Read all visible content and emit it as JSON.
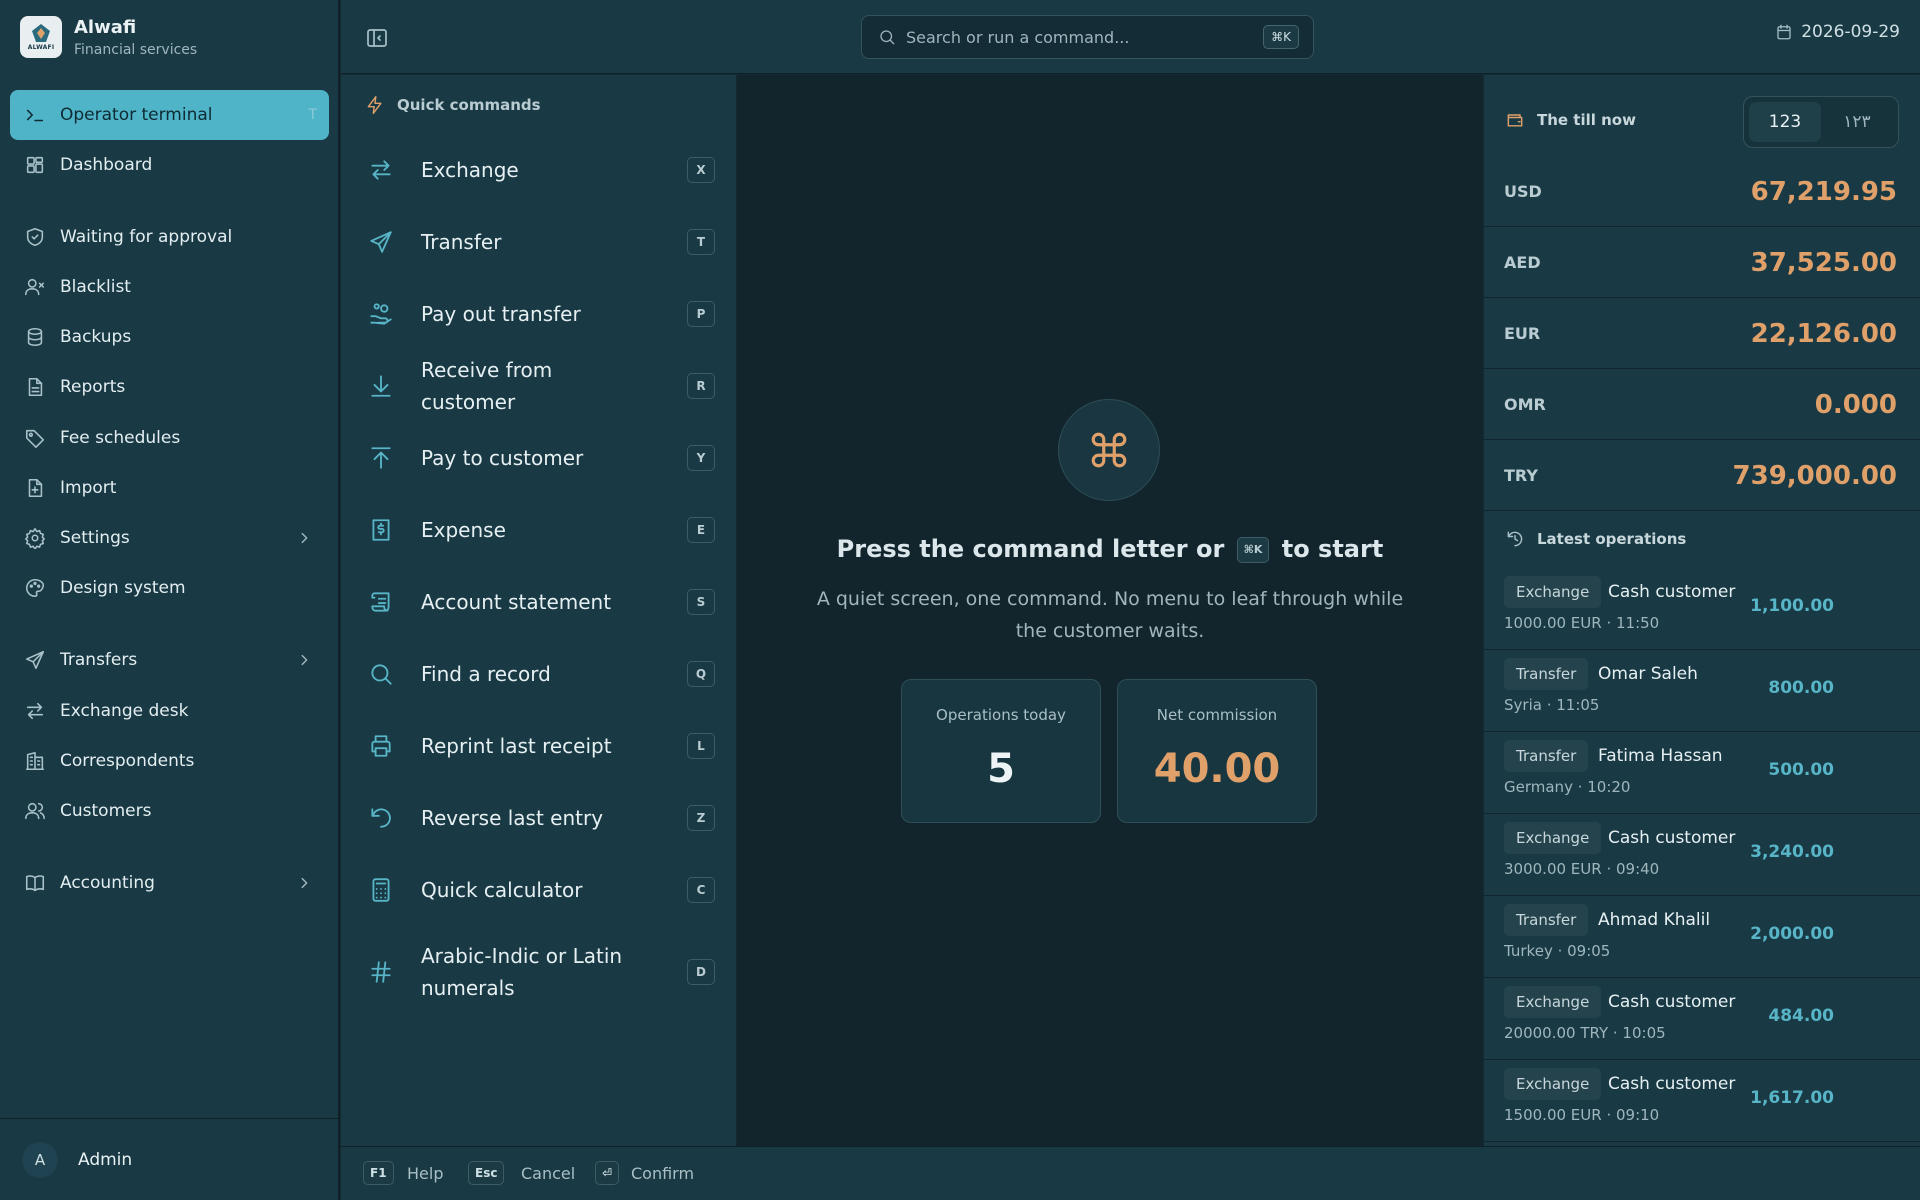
{
  "app": {
    "name": "Alwafi",
    "subtitle": "Financial services",
    "logo_text": "ALWAFI"
  },
  "sidebar": {
    "items": [
      {
        "label": "Operator terminal",
        "shortcut": "T",
        "icon": "terminal-icon",
        "active": true
      },
      {
        "label": "Dashboard",
        "icon": "dashboard-icon"
      },
      {
        "label": "Waiting for approval",
        "icon": "shield-check-icon"
      },
      {
        "label": "Blacklist",
        "icon": "user-x-icon"
      },
      {
        "label": "Backups",
        "icon": "database-icon"
      },
      {
        "label": "Reports",
        "icon": "file-text-icon"
      },
      {
        "label": "Fee schedules",
        "icon": "tag-icon"
      },
      {
        "label": "Import",
        "icon": "file-plus-icon"
      },
      {
        "label": "Settings",
        "icon": "gear-icon",
        "expandable": true
      },
      {
        "label": "Design system",
        "icon": "palette-icon"
      },
      {
        "label": "Transfers",
        "icon": "send-icon",
        "expandable": true
      },
      {
        "label": "Exchange desk",
        "icon": "arrows-exchange-icon"
      },
      {
        "label": "Correspondents",
        "icon": "building-icon"
      },
      {
        "label": "Customers",
        "icon": "users-icon"
      },
      {
        "label": "Accounting",
        "icon": "book-icon",
        "expandable": true
      }
    ],
    "user": {
      "initial": "A",
      "name": "Admin"
    }
  },
  "topbar": {
    "search_placeholder": "Search or run a command...",
    "search_shortcut": "⌘K",
    "date": "2026-09-29"
  },
  "commands": {
    "title": "Quick commands",
    "items": [
      {
        "label": "Exchange",
        "key": "X",
        "icon": "arrows-exchange-icon"
      },
      {
        "label": "Transfer",
        "key": "T",
        "icon": "send-icon"
      },
      {
        "label": "Pay out transfer",
        "key": "P",
        "icon": "hand-coins-icon"
      },
      {
        "label": "Receive from customer",
        "key": "R",
        "icon": "arrow-down-icon"
      },
      {
        "label": "Pay to customer",
        "key": "Y",
        "icon": "arrow-up-icon"
      },
      {
        "label": "Expense",
        "key": "E",
        "icon": "receipt-dollar-icon"
      },
      {
        "label": "Account statement",
        "key": "S",
        "icon": "scroll-icon"
      },
      {
        "label": "Find a record",
        "key": "Q",
        "icon": "search-icon"
      },
      {
        "label": "Reprint last receipt",
        "key": "L",
        "icon": "printer-icon"
      },
      {
        "label": "Reverse last entry",
        "key": "Z",
        "icon": "undo-icon"
      },
      {
        "label": "Quick calculator",
        "key": "C",
        "icon": "calculator-icon"
      },
      {
        "label": "Arabic-Indic or Latin numerals",
        "key": "D",
        "icon": "hash-icon"
      }
    ]
  },
  "main": {
    "press_before": "Press the command letter or",
    "press_key": "⌘K",
    "press_after": "to start",
    "quiet_text": "A quiet screen, one command. No menu to leaf through while the customer waits.",
    "stats": [
      {
        "label": "Operations today",
        "value": "5"
      },
      {
        "label": "Net commission",
        "value": "40.00"
      }
    ]
  },
  "till": {
    "title": "The till now",
    "numeral_options": [
      "123",
      "١٢٣"
    ],
    "selected_numeral": "123",
    "currencies": [
      {
        "code": "USD",
        "amount": "67,219.95"
      },
      {
        "code": "AED",
        "amount": "37,525.00"
      },
      {
        "code": "EUR",
        "amount": "22,126.00"
      },
      {
        "code": "OMR",
        "amount": "0.000"
      },
      {
        "code": "TRY",
        "amount": "739,000.00"
      }
    ]
  },
  "operations": {
    "title": "Latest operations",
    "items": [
      {
        "type": "Exchange",
        "who": "Cash customer",
        "meta": "1000.00 EUR · 11:50",
        "amount": "1,100.00"
      },
      {
        "type": "Transfer",
        "who": "Omar Saleh",
        "meta": "Syria · 11:05",
        "amount": "800.00"
      },
      {
        "type": "Transfer",
        "who": "Fatima Hassan",
        "meta": "Germany · 10:20",
        "amount": "500.00"
      },
      {
        "type": "Exchange",
        "who": "Cash customer",
        "meta": "3000.00 EUR · 09:40",
        "amount": "3,240.00"
      },
      {
        "type": "Transfer",
        "who": "Ahmad Khalil",
        "meta": "Turkey · 09:05",
        "amount": "2,000.00"
      },
      {
        "type": "Exchange",
        "who": "Cash customer",
        "meta": "20000.00 TRY · 10:05",
        "amount": "484.00"
      },
      {
        "type": "Exchange",
        "who": "Cash customer",
        "meta": "1500.00 EUR · 09:10",
        "amount": "1,617.00"
      }
    ]
  },
  "footer": [
    {
      "key": "F1",
      "label": "Help"
    },
    {
      "key": "Esc",
      "label": "Cancel"
    },
    {
      "key": "⏎",
      "label": "Confirm"
    }
  ],
  "colors": {
    "accent": "#4fb4c8",
    "amber": "#e0a06a",
    "background": "#12252d",
    "panel": "#193944"
  }
}
